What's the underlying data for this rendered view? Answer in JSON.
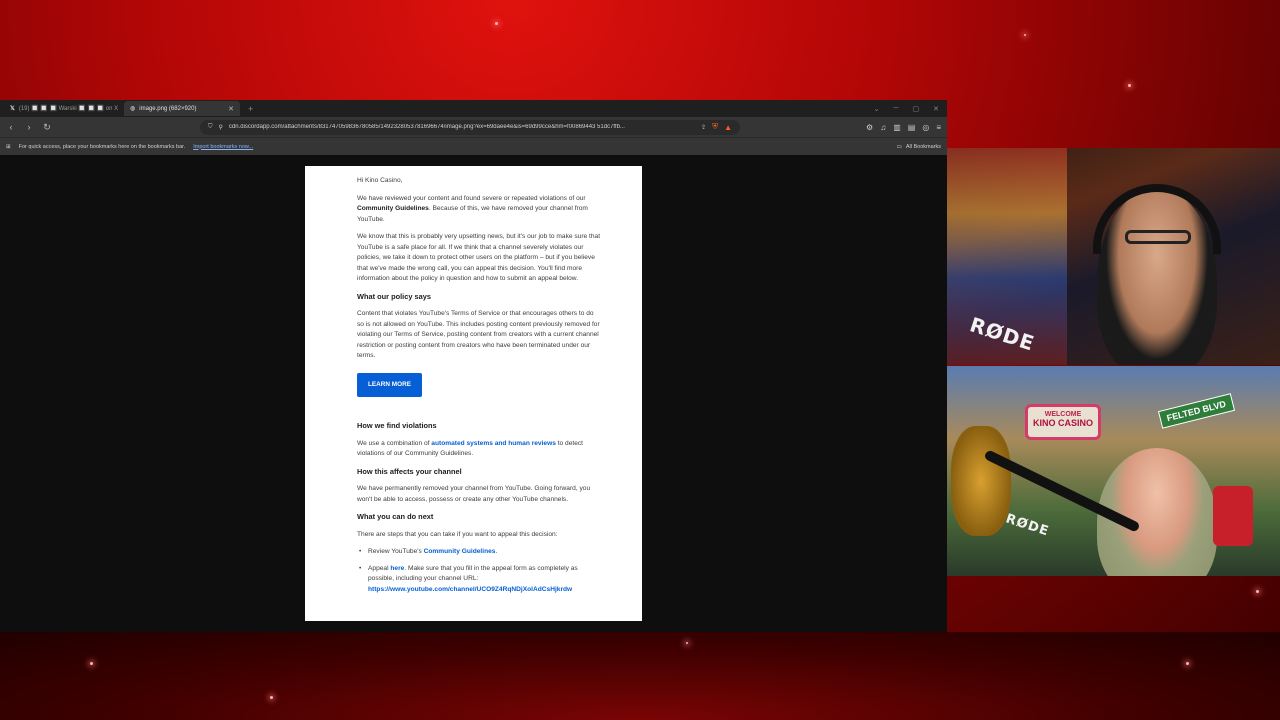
{
  "browser": {
    "tabs": [
      {
        "label": "(19) 🔲 🔲 🔲 Warski 🔲 🔲 🔲 on X",
        "active": false
      },
      {
        "label": "image.png (682×920)",
        "active": true
      }
    ],
    "new_tab_label": "+",
    "address": "cdn.discordapp.com/attachments/831747059836780585/1492328053781696674/image.png?ex=69daee4e&is=69d99cce&hm=f00869443 51dc7ffb...",
    "bookmarks_hint": "For quick access, place your bookmarks here on the bookmarks bar.",
    "import_link": "Import bookmarks now...",
    "all_bookmarks": "All Bookmarks"
  },
  "email": {
    "greeting": "Hi Kino Casino,",
    "p1_pre": "We have reviewed your content and found severe or repeated violations of our ",
    "p1_bold": "Community Guidelines",
    "p1_post": ". Because of this, we have removed your channel from YouTube.",
    "p2": "We know that this is probably very upsetting news, but it's our job to make sure that YouTube is a safe place for all. If we think that a channel severely violates our policies, we take it down to protect other users on the platform – but if you believe that we've made the wrong call, you can appeal this decision. You'll find more information about the policy in question and how to submit an appeal below.",
    "h_policy": "What our policy says",
    "p_policy": "Content that violates YouTube's Terms of Service or that encourages others to do so is not allowed on YouTube. This includes posting content previously removed for violating our Terms of Service, posting content from creators with a current channel restriction or posting content from creators who have been terminated under our terms.",
    "learn_more": "LEARN MORE",
    "h_find": "How we find violations",
    "p_find_pre": "We use a combination of ",
    "p_find_link": "automated systems and human reviews",
    "p_find_post": " to detect violations of our Community Guidelines.",
    "h_affects": "How this affects your channel",
    "p_affects": "We have permanently removed your channel from YouTube. Going forward, you won't be able to access, possess or create any other YouTube channels.",
    "h_next": "What you can do next",
    "p_next": "There are steps that you can take if you want to appeal this decision:",
    "li1_pre": "Review YouTube's ",
    "li1_link": "Community Guidelines",
    "li1_post": ".",
    "li2_pre": "Appeal ",
    "li2_link": "here",
    "li2_mid": ". Make sure that you fill in the appeal form as completely as possible, including your channel URL: ",
    "li2_url": "https://www.youtube.com/channel/UCO9Z4RqNDjXolAdCsHjkrdw"
  },
  "webcams": {
    "mic_brand": "RØDE",
    "sign_top": "WELCOME",
    "sign_main": "KINO CASINO",
    "street_sign": "FELTED BLVD"
  },
  "colors": {
    "background_red": "#b00606",
    "youtube_blue": "#065fd4",
    "browser_dark": "#353535"
  }
}
